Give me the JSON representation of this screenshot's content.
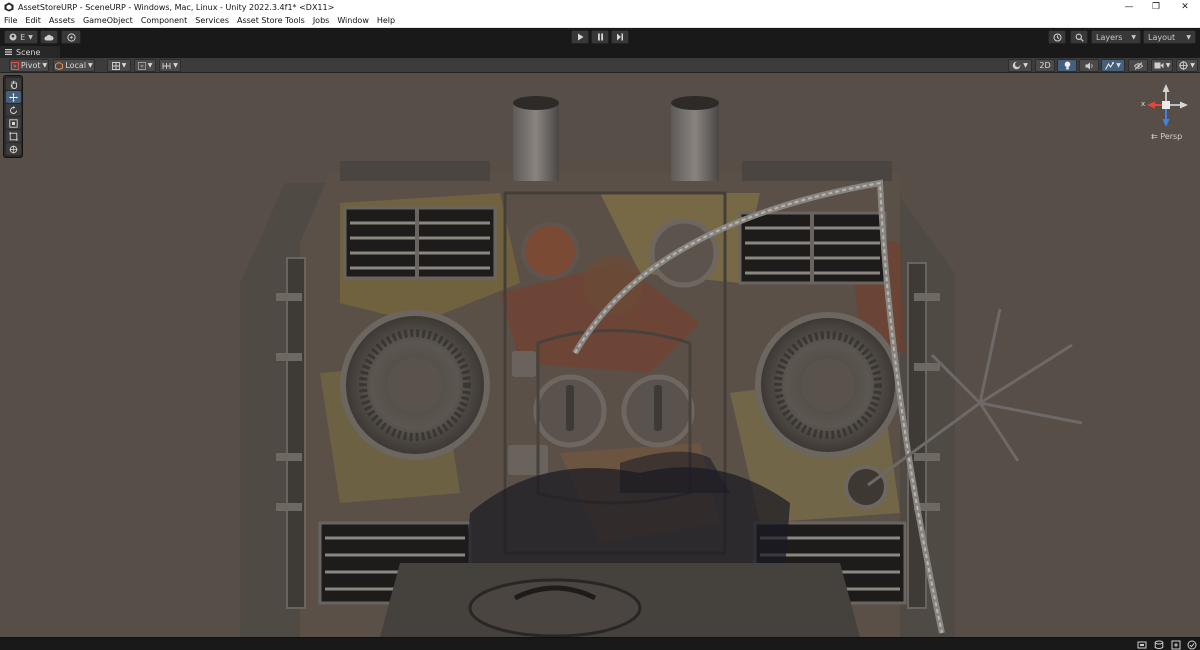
{
  "window": {
    "title": "AssetStoreURP - SceneURP - Windows, Mac, Linux - Unity 2022.3.4f1* <DX11>",
    "controls": [
      "minimize-icon",
      "restore-icon",
      "close-icon"
    ]
  },
  "menu": [
    "File",
    "Edit",
    "Assets",
    "GameObject",
    "Component",
    "Services",
    "Asset Store Tools",
    "Jobs",
    "Window",
    "Help"
  ],
  "toolbar": {
    "account_label": "E",
    "layers_label": "Layers",
    "layout_label": "Layout",
    "play_icon": "play-icon",
    "pause_icon": "pause-icon",
    "step_icon": "step-icon"
  },
  "scene_tab": {
    "label": "Scene"
  },
  "scene_toolbar": {
    "pivot_label": "Pivot",
    "local_label": "Local",
    "mode_2d_label": "2D"
  },
  "gizmo": {
    "x_label": "x",
    "projection_label": "Persp"
  },
  "colors": {
    "editor_bg": "#191919",
    "viewport_bg": "#574e48",
    "active_blue": "#46607c",
    "gizmo_x": "#e8453c",
    "gizmo_y": "#9bd14a",
    "gizmo_z": "#3f7ff0"
  }
}
